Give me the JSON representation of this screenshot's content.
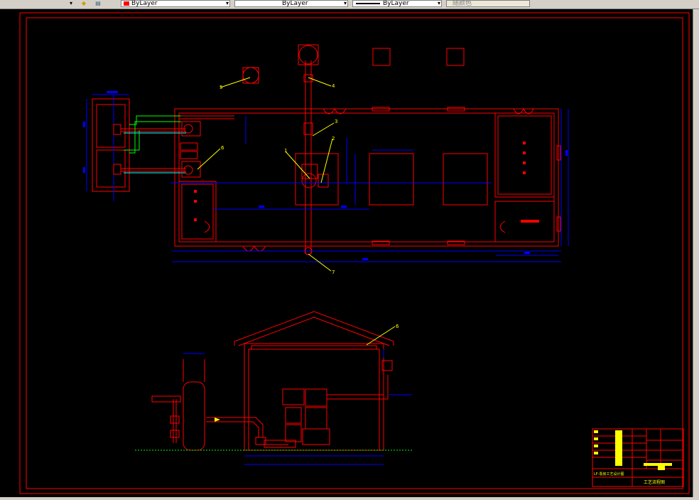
{
  "toolbar": {
    "color_value": "ByLayer",
    "linetype_value": "ByLayer",
    "lineweight_value": "ByLayer",
    "plotstyle_value": "随颜色",
    "layer_color_hex": "#ff0000"
  },
  "drawing": {
    "plan_labels": {
      "leader_1": "1",
      "leader_2": "2",
      "leader_3": "3",
      "leader_4": "4",
      "leader_5": "5",
      "leader_6": "6",
      "leader_7": "7"
    },
    "elevation_labels": {
      "leader_6": "6"
    },
    "title_block": {
      "drawing_name": "工艺流程图",
      "project_name": "LF-泵房工艺设计图"
    }
  },
  "colors": {
    "background": "#000000",
    "wall": "#ff0000",
    "dimension": "#0000ff",
    "leader": "#ffff00",
    "pipe_green": "#00ff00",
    "frame": "#ff0000",
    "title_fill": "#ffff00"
  },
  "icons": {
    "layer_state_icon": "layer-state-icon",
    "layer_prev_icon": "layer-previous-icon"
  }
}
